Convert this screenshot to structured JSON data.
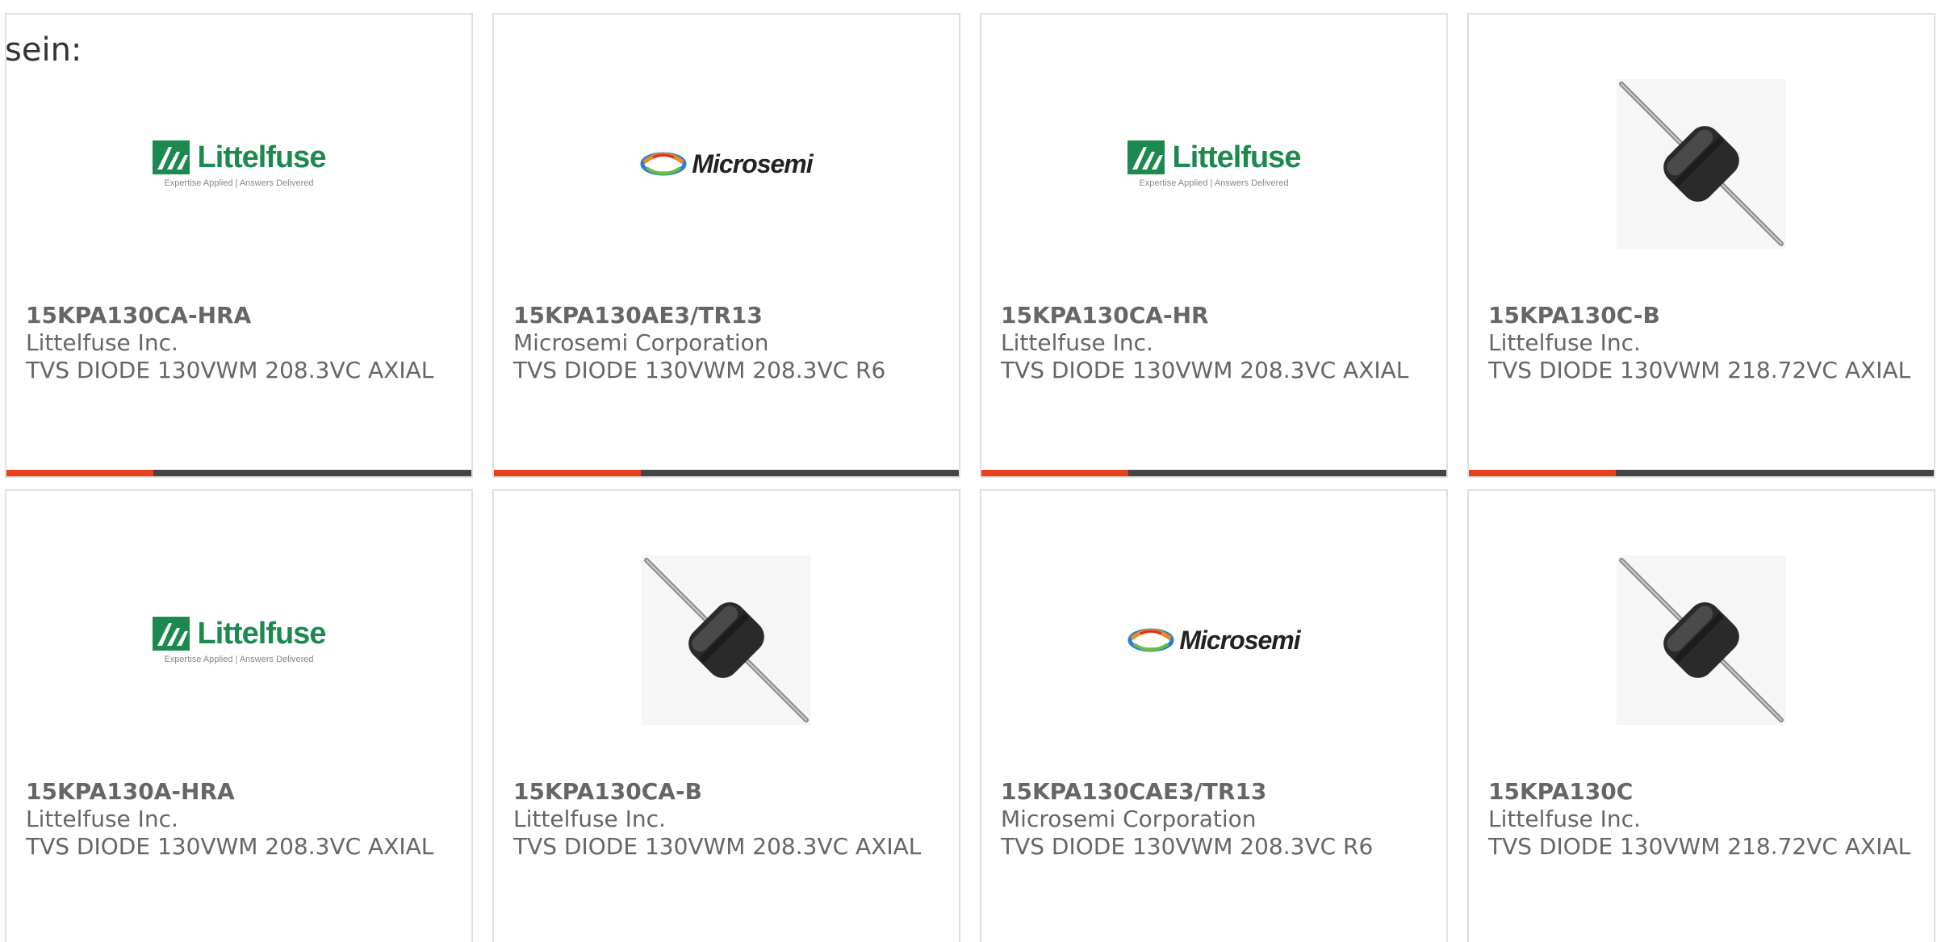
{
  "intro_text": "sein:",
  "colors": {
    "card_border": "#e0e0e0",
    "text": "#666666",
    "bar_dark": "#444444",
    "bar_accent": "#e8401c",
    "littelfuse_green": "#1c8a4e"
  },
  "logos": {
    "littelfuse": {
      "name": "Littelfuse",
      "tagline": "Expertise Applied | Answers Delivered"
    },
    "microsemi": {
      "name": "Microsemi"
    }
  },
  "products": [
    {
      "image": "littelfuse-logo",
      "part_number": "15KPA130CA-HRA",
      "manufacturer": "Littelfuse Inc.",
      "description": "TVS DIODE 130VWM 208.3VC AXIAL"
    },
    {
      "image": "microsemi-logo",
      "part_number": "15KPA130AE3/TR13",
      "manufacturer": "Microsemi Corporation",
      "description": "TVS DIODE 130VWM 208.3VC R6"
    },
    {
      "image": "littelfuse-logo",
      "part_number": "15KPA130CA-HR",
      "manufacturer": "Littelfuse Inc.",
      "description": "TVS DIODE 130VWM 208.3VC AXIAL"
    },
    {
      "image": "diode-photo",
      "part_number": "15KPA130C-B",
      "manufacturer": "Littelfuse Inc.",
      "description": "TVS DIODE 130VWM 218.72VC AXIAL"
    },
    {
      "image": "littelfuse-logo",
      "part_number": "15KPA130A-HRA",
      "manufacturer": "Littelfuse Inc.",
      "description": "TVS DIODE 130VWM 208.3VC AXIAL"
    },
    {
      "image": "diode-photo",
      "part_number": "15KPA130CA-B",
      "manufacturer": "Littelfuse Inc.",
      "description": "TVS DIODE 130VWM 208.3VC AXIAL"
    },
    {
      "image": "microsemi-logo",
      "part_number": "15KPA130CAE3/TR13",
      "manufacturer": "Microsemi Corporation",
      "description": "TVS DIODE 130VWM 208.3VC R6"
    },
    {
      "image": "diode-photo",
      "part_number": "15KPA130C",
      "manufacturer": "Littelfuse Inc.",
      "description": "TVS DIODE 130VWM 218.72VC AXIAL"
    }
  ]
}
